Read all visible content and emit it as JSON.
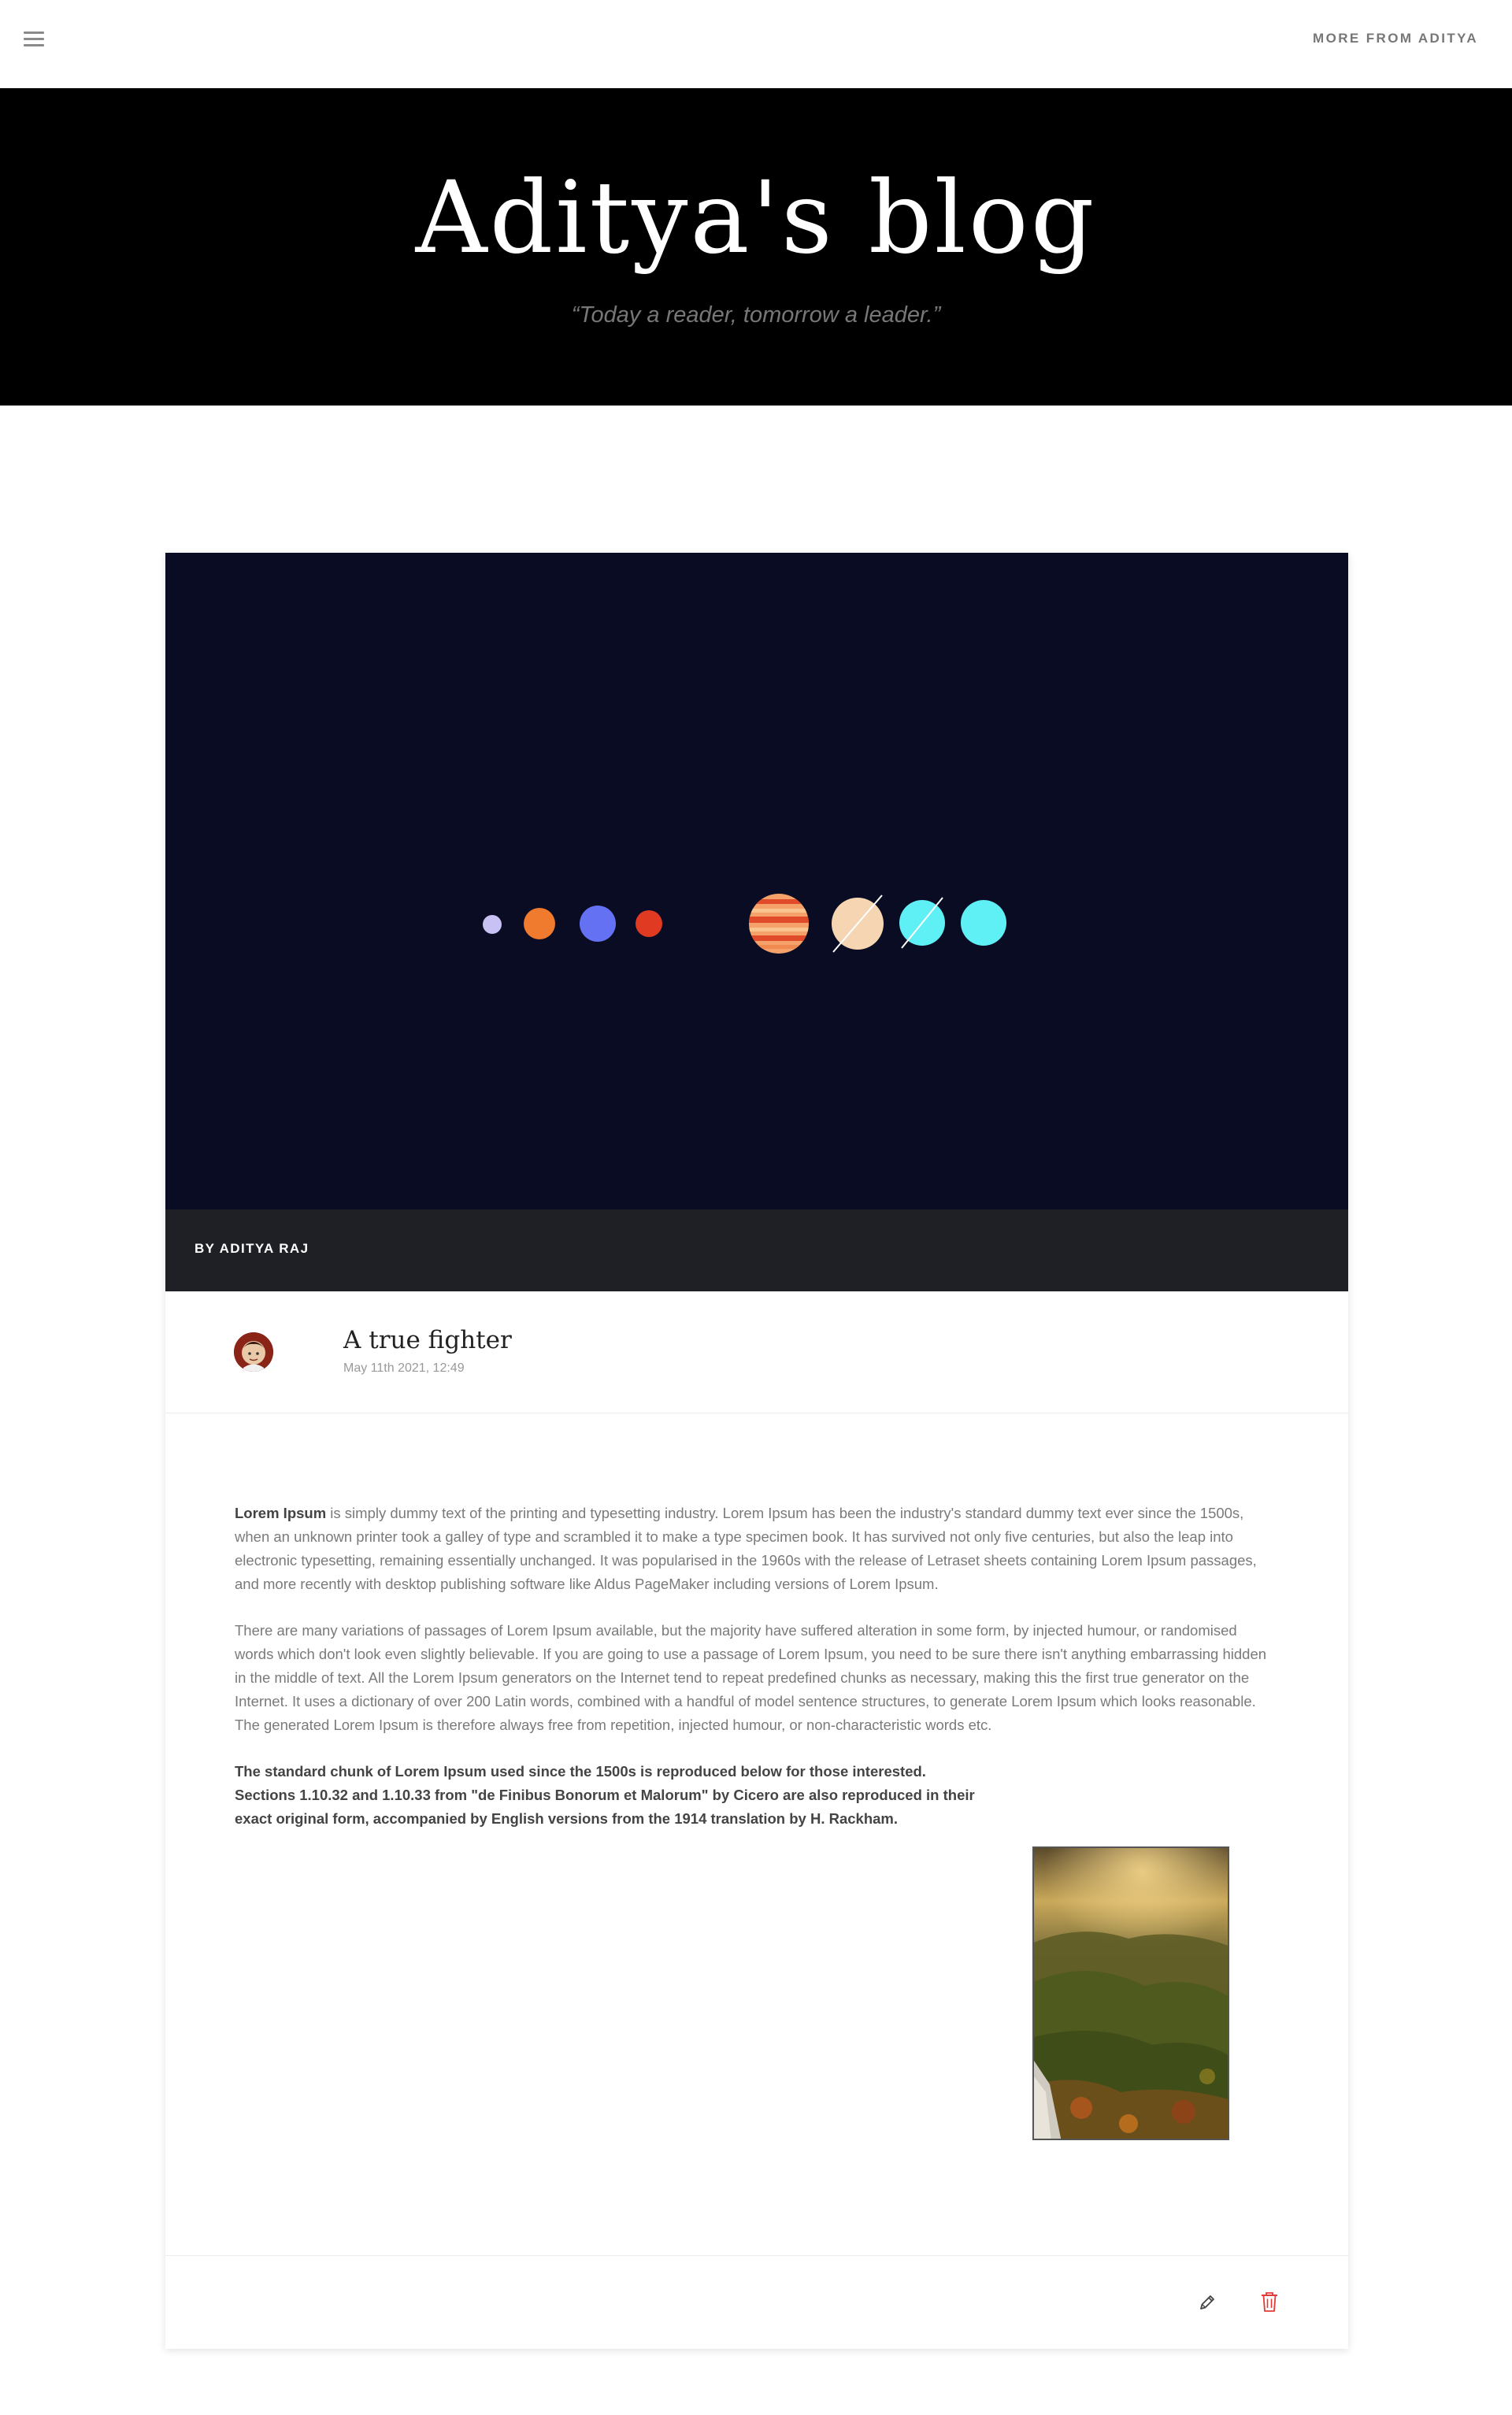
{
  "nav": {
    "menu_icon": "hamburger-menu-icon",
    "more_link": "MORE FROM ADITYA"
  },
  "hero": {
    "title": "Aditya's blog",
    "tagline": "“Today a reader, tomorrow a leader.”"
  },
  "post": {
    "image_description_icon": "solar-system-illustration",
    "byline": "BY ADITYA RAJ",
    "title": "A true fighter",
    "date": "May 11th 2021, 12:49",
    "body": {
      "p1_bold": "Lorem Ipsum",
      "p1_rest": " is simply dummy text of the printing and typesetting industry. Lorem Ipsum has been the industry's standard dummy text ever since the 1500s, when an unknown printer took a galley of type and scrambled it to make a type specimen book. It has survived not only five centuries, but also the leap into electronic typesetting, remaining essentially unchanged. It was popularised in the 1960s with the release of Letraset sheets containing Lorem Ipsum passages, and more recently with desktop publishing software like Aldus PageMaker including versions of Lorem Ipsum.",
      "p2": "There are many variations of passages of Lorem Ipsum available, but the majority have suffered alteration in some form, by injected humour, or randomised words which don't look even slightly believable. If you are going to use a passage of Lorem Ipsum, you need to be sure there isn't anything embarrassing hidden in the middle of text. All the Lorem Ipsum generators on the Internet tend to repeat predefined chunks as necessary, making this the first true generator on the Internet. It uses a dictionary of over 200 Latin words, combined with a handful of model sentence structures, to generate Lorem Ipsum which looks reasonable. The generated Lorem Ipsum is therefore always free from repetition, injected humour, or non-characteristic words etc.",
      "p3": "The standard chunk of Lorem Ipsum used since the 1500s is reproduced below for those interested. Sections 1.10.32 and 1.10.33 from \"de Finibus Bonorum et Malorum\" by Cicero are also reproduced in their exact original form, accompanied by English versions from the 1914 translation by H. Rackham."
    },
    "actions": {
      "edit_icon": "pencil-icon",
      "delete_icon": "trash-icon",
      "delete_color": "#e53935"
    }
  },
  "colors": {
    "hero_bg": "#000000",
    "image_bg": "#090c23",
    "byline_bg": "#1f1f26"
  }
}
